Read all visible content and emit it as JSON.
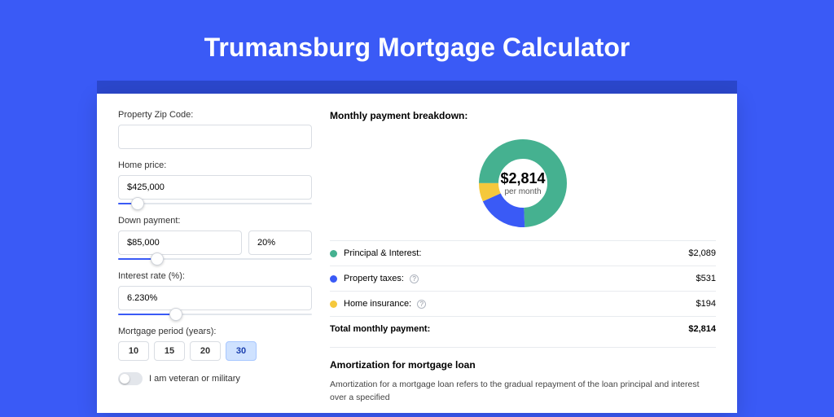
{
  "title": "Trumansburg Mortgage Calculator",
  "form": {
    "zip_label": "Property Zip Code:",
    "zip_value": "",
    "home_price_label": "Home price:",
    "home_price_value": "$425,000",
    "home_price_slider_pct": 10,
    "down_label": "Down payment:",
    "down_value": "$85,000",
    "down_pct": "20%",
    "down_slider_pct": 20,
    "rate_label": "Interest rate (%):",
    "rate_value": "6.230%",
    "rate_slider_pct": 30,
    "term_label": "Mortgage period (years):",
    "terms": [
      "10",
      "15",
      "20",
      "30"
    ],
    "term_selected": "30",
    "veteran_label": "I am veteran or military"
  },
  "breakdown": {
    "title": "Monthly payment breakdown:",
    "center_amount": "$2,814",
    "center_sub": "per month",
    "items": [
      {
        "label": "Principal & Interest:",
        "amount": "$2,089",
        "color": "g",
        "info": false
      },
      {
        "label": "Property taxes:",
        "amount": "$531",
        "color": "b",
        "info": true
      },
      {
        "label": "Home insurance:",
        "amount": "$194",
        "color": "y",
        "info": true
      }
    ],
    "total_label": "Total monthly payment:",
    "total_amount": "$2,814"
  },
  "amort": {
    "title": "Amortization for mortgage loan",
    "text": "Amortization for a mortgage loan refers to the gradual repayment of the loan principal and interest over a specified"
  },
  "chart_data": {
    "type": "pie",
    "title": "Monthly payment breakdown",
    "series": [
      {
        "name": "Principal & Interest",
        "value": 2089,
        "color": "#45b190"
      },
      {
        "name": "Property taxes",
        "value": 531,
        "color": "#3a5af6"
      },
      {
        "name": "Home insurance",
        "value": 194,
        "color": "#f5c83c"
      }
    ],
    "total": 2814,
    "center_label": "$2,814 per month"
  }
}
